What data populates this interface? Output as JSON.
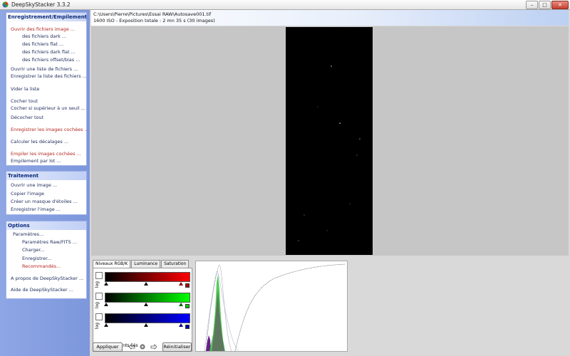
{
  "window": {
    "title": "DeepSkyStacker 3.3.2"
  },
  "sidebar": {
    "stacking": {
      "header": "Enregistrement/Empilement",
      "items": [
        {
          "label": "Ouvrir des fichiers image ...",
          "style": "red"
        },
        {
          "label": "des fichiers dark ...",
          "style": "dark"
        },
        {
          "label": "des fichiers flat ...",
          "style": "dark"
        },
        {
          "label": "des fichiers dark flat ...",
          "style": "dark"
        },
        {
          "label": "des fichiers offset/bias ...",
          "style": "dark"
        },
        {
          "label": "Ouvrir une liste de fichiers ...",
          "style": "dark"
        },
        {
          "label": "Enregistrer la liste des fichiers ...",
          "style": "dark"
        },
        {
          "label": "Vider la liste",
          "style": "dark"
        },
        {
          "label": "Cocher tout",
          "style": "dark"
        },
        {
          "label": "Cocher si supérieur à un seuil ...",
          "style": "dark"
        },
        {
          "label": "Décocher tout",
          "style": "dark"
        },
        {
          "label": "Enregistrer les images cochées ...",
          "style": "red"
        },
        {
          "label": "Calculer les décalages ...",
          "style": "dark"
        },
        {
          "label": "Empiler les images cochées ...",
          "style": "red"
        },
        {
          "label": "Empilement par lot ...",
          "style": "dark"
        }
      ]
    },
    "processing": {
      "header": "Traitement",
      "items": [
        {
          "label": "Ouvrir une image ..."
        },
        {
          "label": "Copier l'image"
        },
        {
          "label": "Créer un masque d'étoiles ..."
        },
        {
          "label": "Enregistrer l'image ..."
        }
      ]
    },
    "options": {
      "header": "Options",
      "items": [
        {
          "label": "Paramètres...",
          "style": "dark"
        },
        {
          "label": "Paramètres Raw/FITS ...",
          "style": "dark"
        },
        {
          "label": "Charger...",
          "style": "dark"
        },
        {
          "label": "Enregistrer...",
          "style": "dark"
        },
        {
          "label": "Recommandés...",
          "style": "red"
        },
        {
          "label": "A propos de DeepSkyStacker ...",
          "style": "dark"
        },
        {
          "label": "Aide de DeepSkyStacker ...",
          "style": "dark"
        }
      ]
    }
  },
  "info": {
    "path": "C:\\Users\\Pierre\\Pictures\\Essai RAW\\Autosave001.tif",
    "details": "1600 ISO - Exposition totale : 2 mn 35 s (30 images)"
  },
  "adjust": {
    "tabs": [
      "Niveaux RGB/K",
      "Luminance",
      "Saturation"
    ],
    "log_label": "log",
    "linked_label": "Ajustements liés",
    "apply_button": "Appliquer",
    "reset_button": "Réinitialiser",
    "channels": [
      {
        "name": "red",
        "color": "#ff0000"
      },
      {
        "name": "green",
        "color": "#00ff00"
      },
      {
        "name": "blue",
        "color": "#0000ff"
      }
    ]
  },
  "icons": {
    "app": "app-logo-icon",
    "undo": "undo-icon",
    "settings": "gear-icon",
    "redo": "redo-icon"
  }
}
